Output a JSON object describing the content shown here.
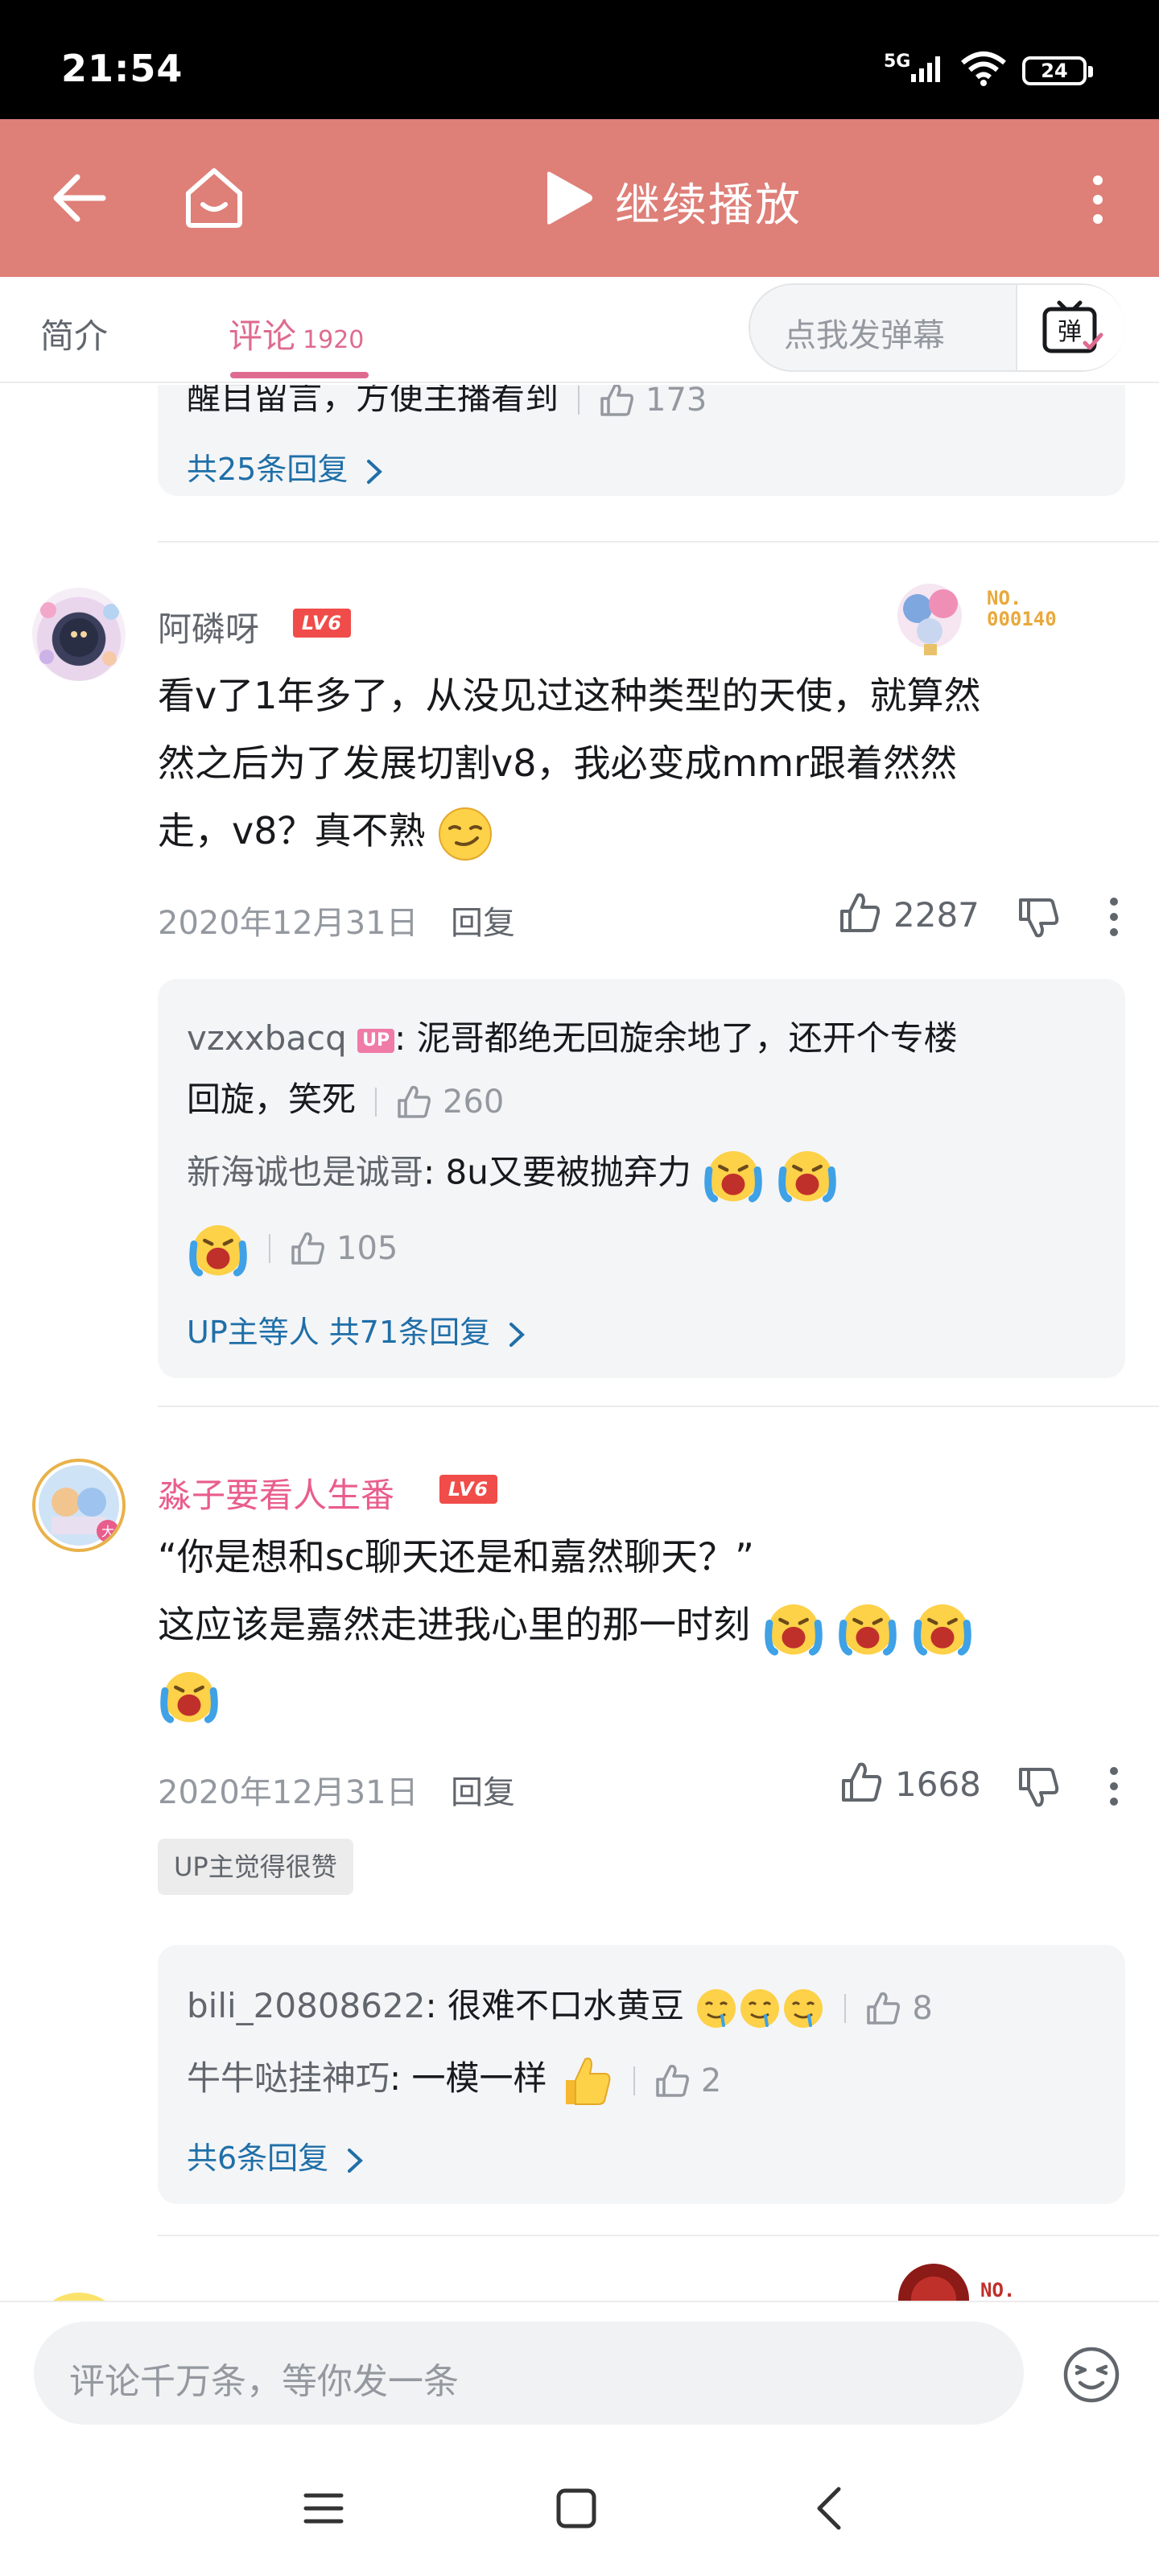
{
  "status_bar": {
    "time": "21:54",
    "network": "5G",
    "battery": "24"
  },
  "header": {
    "title": "继续播放"
  },
  "tabs": {
    "intro": "简介",
    "comments": "评论",
    "comment_count": "1920"
  },
  "danmu": {
    "placeholder": "点我发弹幕",
    "button": "弹"
  },
  "colors": {
    "header_bg": "#de7f78",
    "accent_pink": "#de6b8f",
    "link_blue": "#1f6fa8",
    "level_red": "#f04c49"
  },
  "prev_thread": {
    "partial_text": "醒目留言，方便主播看到",
    "likes": "173",
    "more": "共25条回复"
  },
  "comments": [
    {
      "user": "阿磷呀",
      "level": "LV6",
      "fan_number": "NO.\n000140",
      "lines": [
        "看v了1年多了，从没见过这种类型的天使，就算然",
        "然之后为了发展切割v8，我必变成mmr跟着然然",
        "走，v8？真不熟"
      ],
      "date": "2020年12月31日",
      "reply_label": "回复",
      "likes": "2287",
      "replies": [
        {
          "user": "vzxxbacq",
          "up_badge": "UP",
          "text_line1": "泥哥都绝无回旋余地了，还开个专楼",
          "text_line2": "回旋，笑死",
          "likes": "260"
        },
        {
          "user": "新海诚也是诚哥",
          "text": "8u又要被抛弃力",
          "likes": "105"
        }
      ],
      "more": "UP主等人 共71条回复"
    },
    {
      "user": "淼子要看人生番",
      "level": "LV6",
      "line1": "“你是想和sc聊天还是和嘉然聊天？”",
      "line2": "这应该是嘉然走进我心里的那一时刻",
      "date": "2020年12月31日",
      "reply_label": "回复",
      "likes": "1668",
      "up_tag": "UP主觉得很赞",
      "replies": [
        {
          "user": "bili_20808622",
          "text": "很难不口水黄豆",
          "likes": "8"
        },
        {
          "user": "牛牛哒挂神巧",
          "text": "一模一样",
          "likes": "2"
        }
      ],
      "more": "共6条回复"
    }
  ],
  "next_fan_number": "NO.",
  "bottom_input": {
    "placeholder": "评论千万条，等你发一条"
  },
  "icons": [
    "back-arrow-icon",
    "home-icon",
    "play-icon",
    "more-vertical-icon",
    "danmu-toggle-icon",
    "thumb-up-icon",
    "thumb-down-icon",
    "emoji-icon",
    "menu-icon",
    "square-icon",
    "back-nav-icon"
  ]
}
